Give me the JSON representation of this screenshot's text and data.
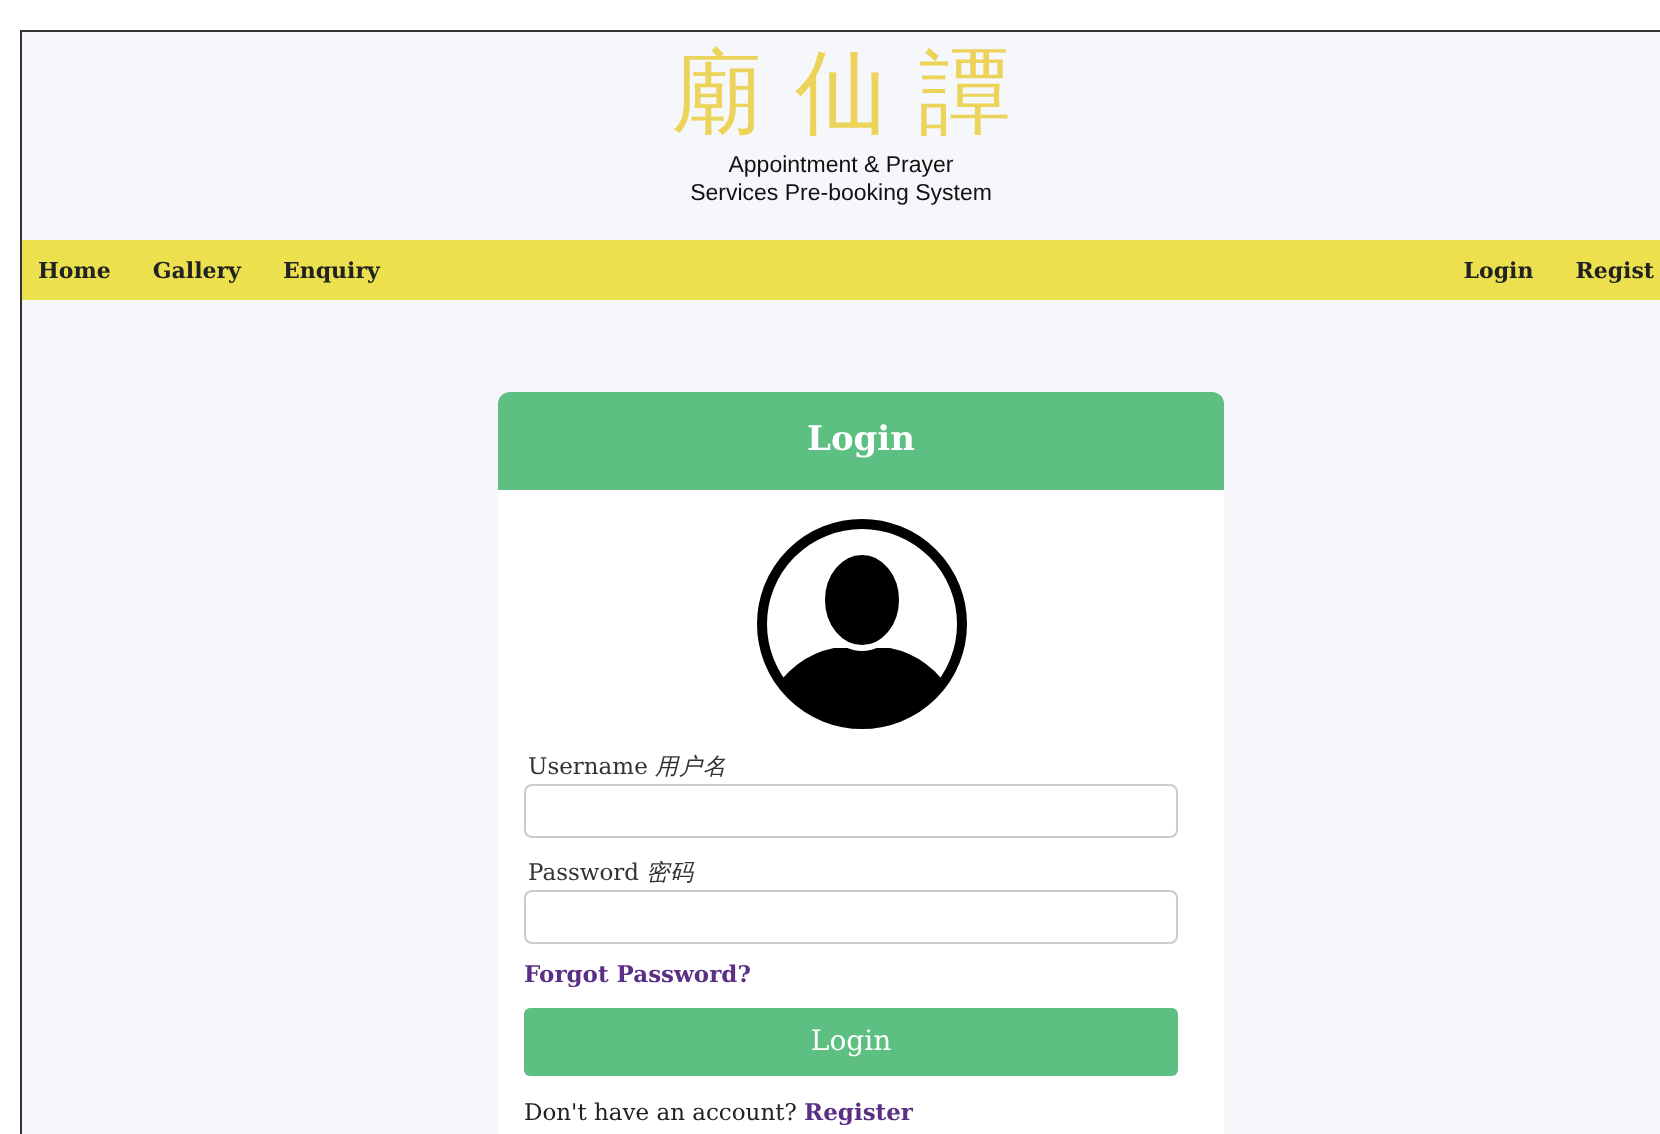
{
  "header": {
    "logo": "廟仙譚",
    "subtitle_lines": [
      "Appointment & Prayer",
      "Services Pre-booking System"
    ]
  },
  "nav": {
    "left": [
      "Home",
      "Gallery",
      "Enquiry"
    ],
    "right": [
      "Login",
      "Regist"
    ]
  },
  "login_card": {
    "title": "Login",
    "fields": [
      {
        "label": "Username *用户名*"
      },
      {
        "label": "Password *密码*"
      }
    ],
    "forgot_link": "Forgot Password?",
    "submit": "Login",
    "signup_prompt": "Don't have an account?",
    "signup_link": "Register"
  }
}
